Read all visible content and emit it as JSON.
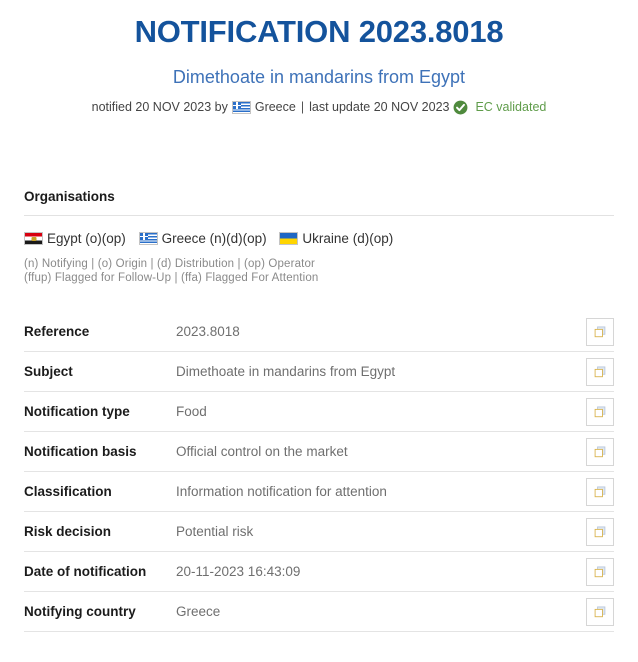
{
  "header": {
    "title": "NOTIFICATION 2023.8018",
    "subtitle": "Dimethoate in mandarins from Egypt",
    "meta_prefix": "notified 20 NOV 2023 by",
    "meta_country": "Greece",
    "meta_separator": "|",
    "meta_last_update": "last update 20 NOV 2023",
    "validation_label": "EC validated",
    "validation_icon": "check-circle-icon",
    "country_flag_icon": "flag-greece-icon",
    "title_color": "#14539c",
    "subtitle_color": "#3e72b8",
    "validation_color": "#5f9c4a"
  },
  "organisations": {
    "heading": "Organisations",
    "items": [
      {
        "flag_icon": "flag-egypt-icon",
        "name": "Egypt",
        "roles": "(o)(op)"
      },
      {
        "flag_icon": "flag-greece-icon",
        "name": "Greece",
        "roles": "(n)(d)(op)"
      },
      {
        "flag_icon": "flag-ukraine-icon",
        "name": "Ukraine",
        "roles": "(d)(op)"
      }
    ],
    "legend_line1": "(n) Notifying | (o) Origin | (d) Distribution | (op) Operator",
    "legend_line2": "(ffup) Flagged for Follow-Up | (ffa) Flagged For Attention"
  },
  "details": {
    "copy_icon": "copy-icon",
    "rows": [
      {
        "label": "Reference",
        "value": "2023.8018"
      },
      {
        "label": "Subject",
        "value": "Dimethoate in mandarins from Egypt"
      },
      {
        "label": "Notification type",
        "value": "Food"
      },
      {
        "label": "Notification basis",
        "value": "Official control on the market"
      },
      {
        "label": "Classification",
        "value": "Information notification for attention"
      },
      {
        "label": "Risk decision",
        "value": "Potential risk"
      },
      {
        "label": "Date of notification",
        "value": "20-11-2023 16:43:09"
      },
      {
        "label": "Notifying country",
        "value": "Greece"
      }
    ]
  }
}
